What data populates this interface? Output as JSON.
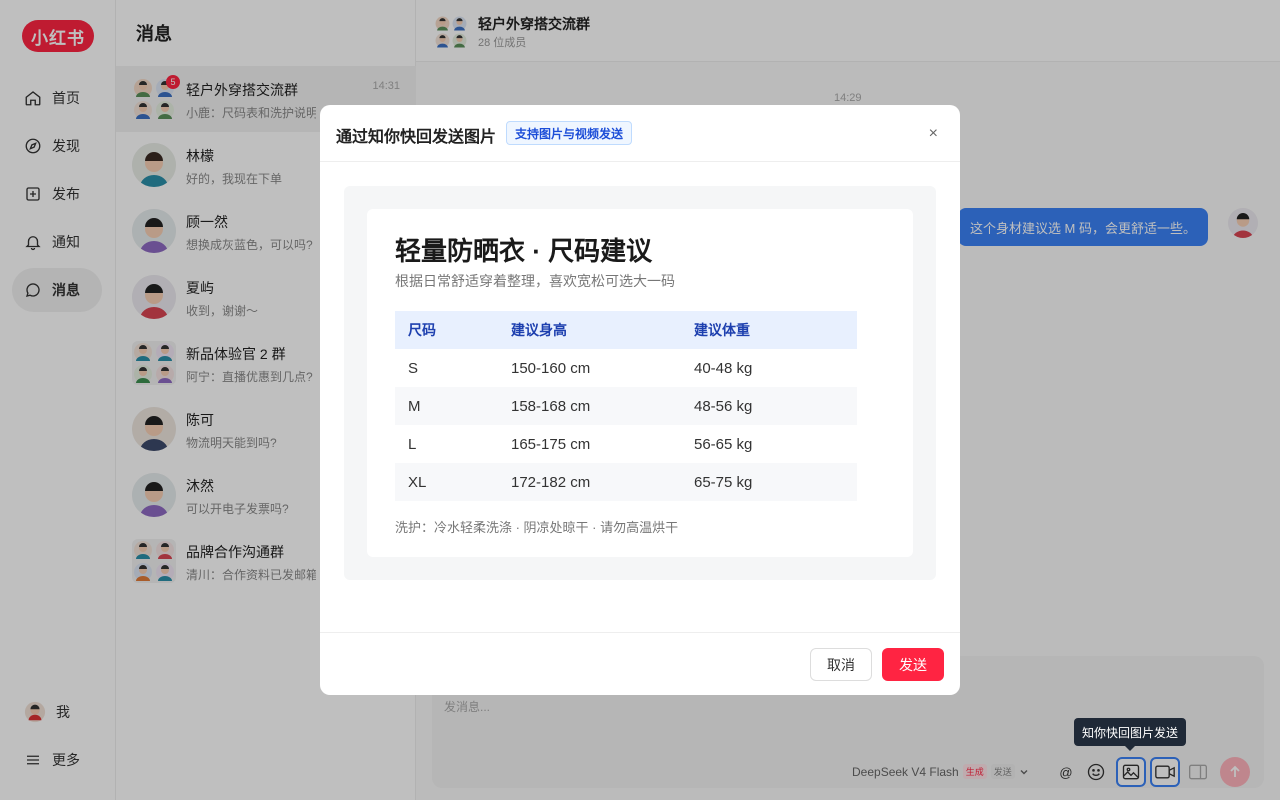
{
  "app": {
    "logo": "小红书"
  },
  "nav": {
    "items": [
      {
        "label": "首页",
        "icon": "home-icon"
      },
      {
        "label": "发现",
        "icon": "compass-icon"
      },
      {
        "label": "发布",
        "icon": "plus-square-icon"
      },
      {
        "label": "通知",
        "icon": "bell-icon"
      },
      {
        "label": "消息",
        "icon": "chat-icon",
        "active": true
      }
    ],
    "me_label": "我",
    "more_label": "更多"
  },
  "messages": {
    "title": "消息",
    "conversations": [
      {
        "name": "轻户外穿搭交流群",
        "preview": "小鹿：尺码表和洗护说明能发下吗？",
        "time": "14:31",
        "badge": "5",
        "group": true
      },
      {
        "name": "林檬",
        "preview": "好的，我现在下单"
      },
      {
        "name": "顾一然",
        "preview": "想换成灰蓝色，可以吗?"
      },
      {
        "name": "夏屿",
        "preview": "收到，谢谢～"
      },
      {
        "name": "新品体验官 2 群",
        "preview": "阿宁：直播优惠到几点?",
        "group": true
      },
      {
        "name": "陈可",
        "preview": "物流明天能到吗?"
      },
      {
        "name": "沐然",
        "preview": "可以开电子发票吗?"
      },
      {
        "name": "品牌合作沟通群",
        "preview": "清川：合作资料已发邮箱",
        "group": true
      }
    ]
  },
  "chat": {
    "title": "轻户外穿搭交流群",
    "members": "28 位成员",
    "time": "14:29",
    "bubble": "这个身材建议选 M 码，会更舒适一些。",
    "placeholder": "发消息...",
    "model": "DeepSeek V4 Flash",
    "tag_gen": "生成",
    "tag_send": "发送",
    "at_symbol": "@",
    "tooltip": "知你快回图片发送"
  },
  "modal": {
    "title": "通过知你快回发送图片",
    "tag": "支持图片与视频发送",
    "close": "×",
    "cancel": "取消",
    "send": "发送",
    "card": {
      "title": "轻量防晒衣 · 尺码建议",
      "subtitle": "根据日常舒适穿着整理，喜欢宽松可选大一码",
      "headers": [
        "尺码",
        "建议身高",
        "建议体重"
      ],
      "rows": [
        [
          "S",
          "150-160 cm",
          "40-48 kg"
        ],
        [
          "M",
          "158-168 cm",
          "48-56 kg"
        ],
        [
          "L",
          "165-175 cm",
          "56-65 kg"
        ],
        [
          "XL",
          "172-182 cm",
          "65-75 kg"
        ]
      ],
      "note": "洗护：冷水轻柔洗涤 · 阴凉处晾干 · 请勿高温烘干"
    }
  },
  "colors": {
    "brand": "#ff2442",
    "accent": "#3b82f6"
  }
}
